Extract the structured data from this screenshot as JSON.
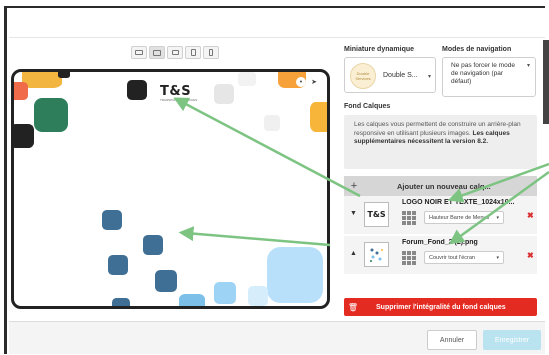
{
  "device_switch": {
    "icons": [
      "desktop-icon",
      "laptop-icon",
      "tablet-landscape-icon",
      "tablet-portrait-icon",
      "mobile-icon"
    ],
    "active": "laptop-icon"
  },
  "preview": {
    "logo_text": "T&S",
    "logo_sub": "TRANSPORT & SERVICES",
    "back_button": "‹",
    "home_button": "•"
  },
  "panel": {
    "mini_label": "Miniature dynamique",
    "mini_value": "Double S...",
    "mini_thumb": "Double Services",
    "nav_label": "Modes de navigation",
    "nav_value": "Ne pas forcer le mode de navigation (par défaut)",
    "fond_label": "Fond Calques",
    "info_text": "Les calques vous permettent de construire un arrière-plan responsive en utilisant plusieurs images.",
    "info_bold": "Les calques supplémentaires nécessitent la version 8.2.",
    "add_plus": "+",
    "add_label": "Ajouter un nouveau calq...",
    "layers": [
      {
        "name": "LOGO NOIR ET TEXTE_1024x10...",
        "position": "Hauteur Barre de Menus",
        "move": "▼"
      },
      {
        "name": "Forum_Fond_2 (2).png",
        "position": "Couvrir tout l'écran",
        "move": "▲"
      }
    ],
    "delete_icon": "✖",
    "danger_label": "Supprimer l'intégralité du fond calques"
  },
  "footer": {
    "cancel": "Annuler",
    "save": "Enregistrer"
  },
  "colors": {
    "arrow": "#7dc483",
    "danger": "#e42b22",
    "save_disabled": "#b9e3ef",
    "shape_blue": "#3f6f94",
    "shape_green": "#2e7d5b"
  }
}
